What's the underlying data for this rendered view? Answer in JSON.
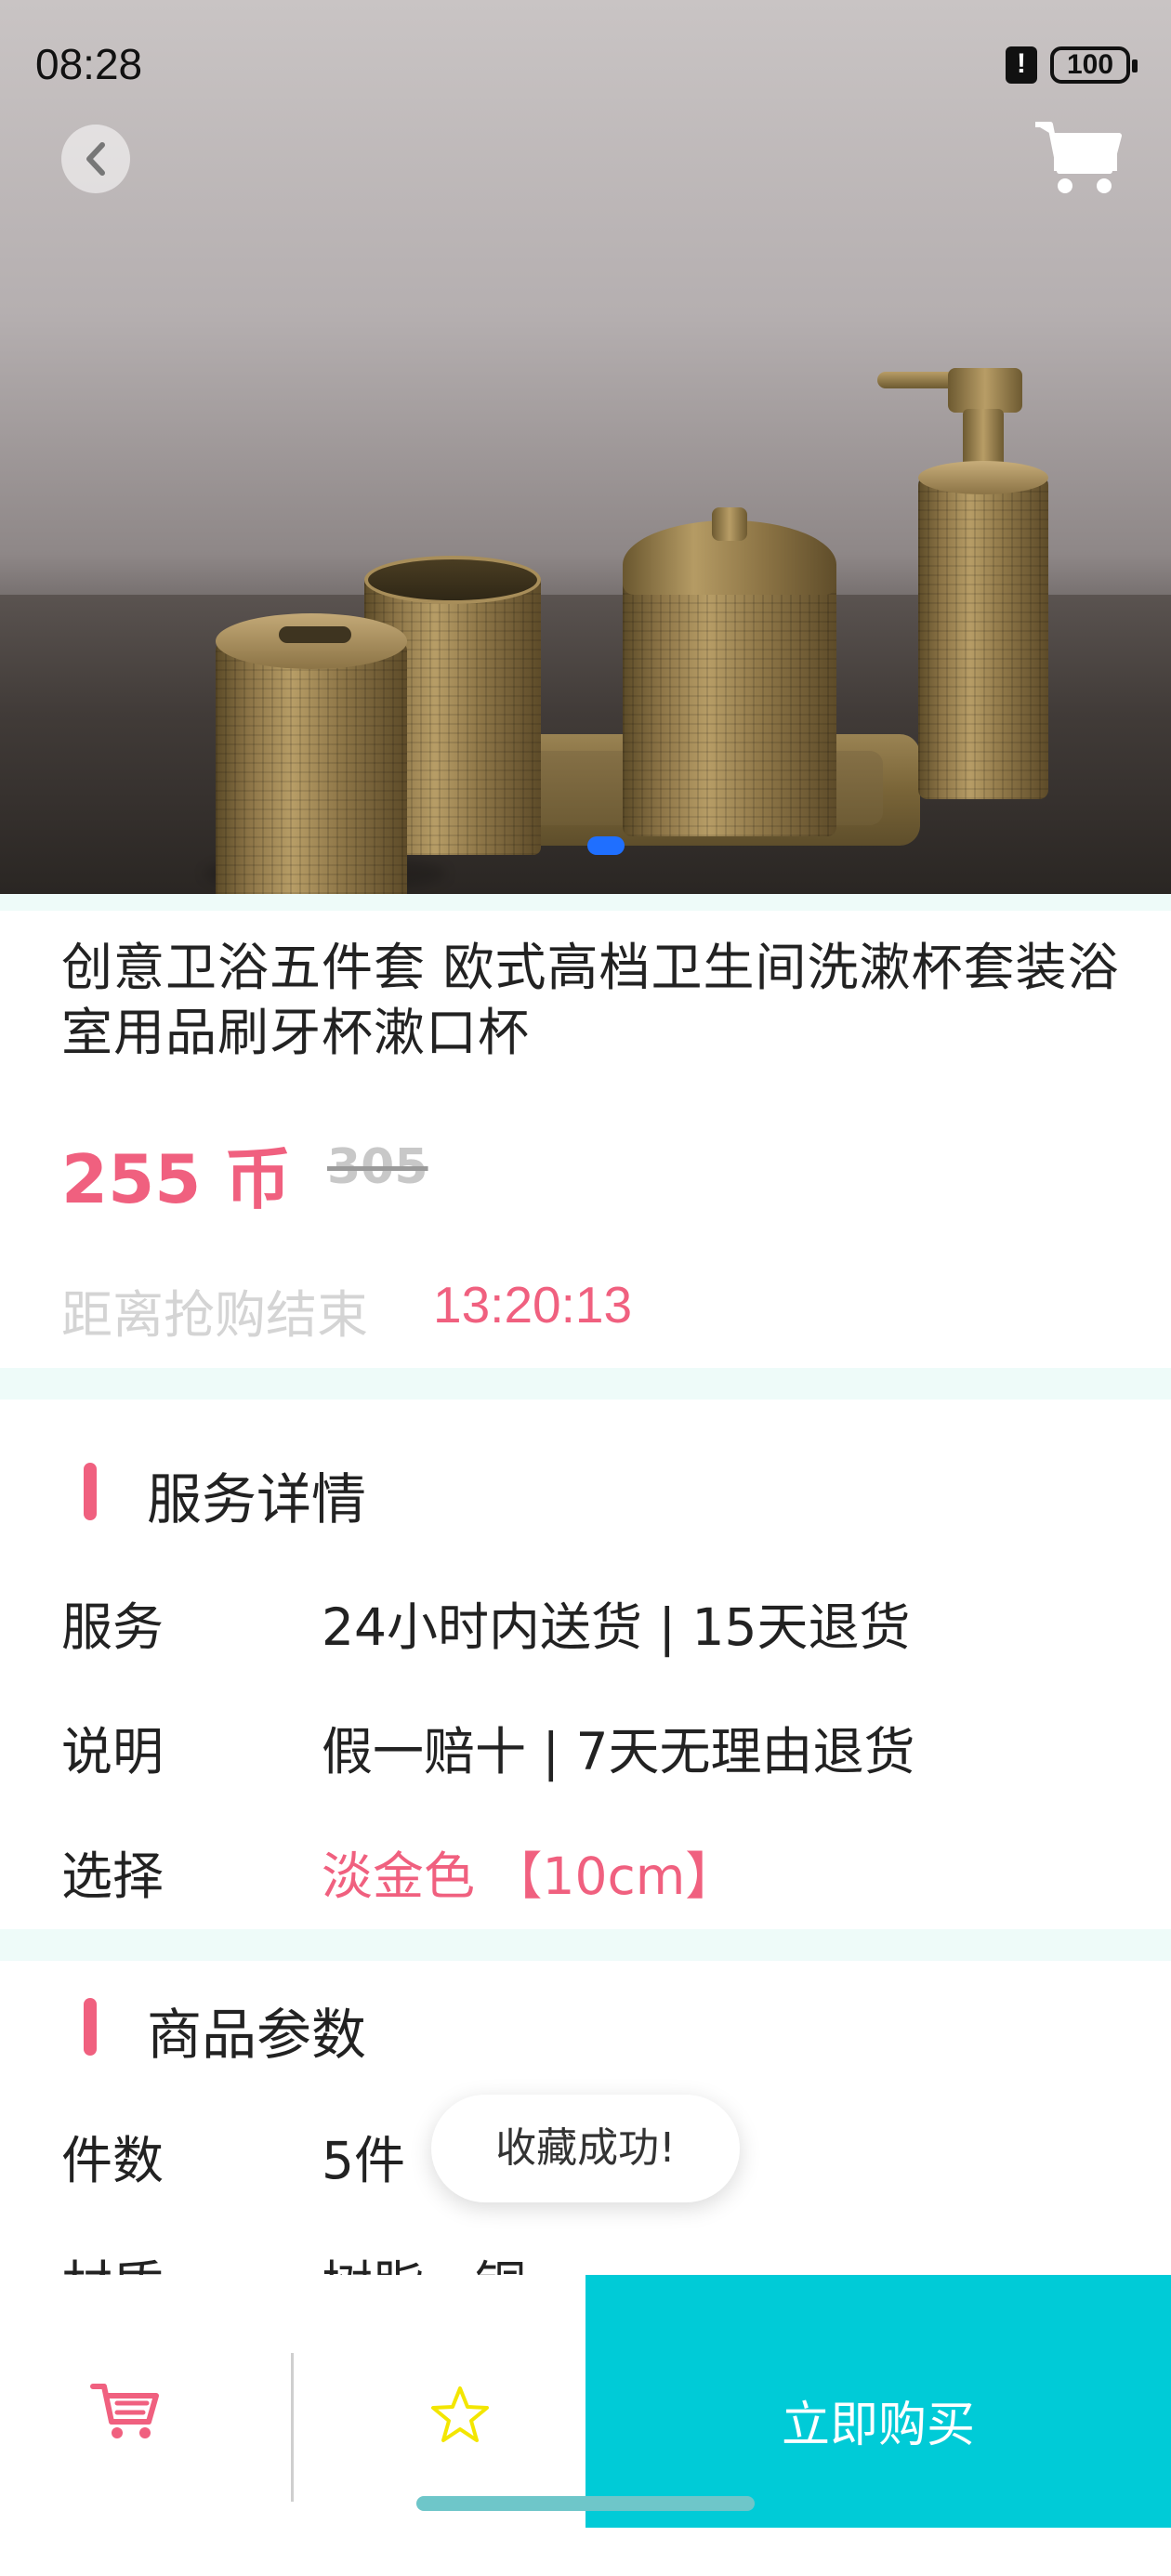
{
  "status_bar": {
    "time": "08:28",
    "battery": "100"
  },
  "product": {
    "title": "创意卫浴五件套 欧式高档卫生间洗漱杯套装浴室用品刷牙杯漱口杯",
    "price": "255 币",
    "old_price": "305",
    "countdown_label": "距离抢购结束",
    "countdown_value": "13:20:13"
  },
  "service_section": {
    "title": "服务详情",
    "rows": [
      {
        "label": "服务",
        "value": "24小时内送货 | 15天退货"
      },
      {
        "label": "说明",
        "value": "假一赔十 | 7天无理由退货"
      },
      {
        "label": "选择",
        "value": "淡金色 【10cm】"
      }
    ]
  },
  "params_section": {
    "title": "商品参数",
    "rows": [
      {
        "label": "件数",
        "value": "5件"
      },
      {
        "label": "材质",
        "value": "树脂、铜"
      }
    ]
  },
  "toast": {
    "text": "收藏成功!"
  },
  "bottom_bar": {
    "buy_label": "立即购买"
  },
  "colors": {
    "accent": "#f0607f",
    "buy_button": "#00cbd7",
    "carousel_dot": "#1f6fff",
    "star": "#f3e600"
  },
  "icons": [
    "back-icon",
    "cart-icon",
    "star-icon",
    "cart-bottom-icon"
  ]
}
